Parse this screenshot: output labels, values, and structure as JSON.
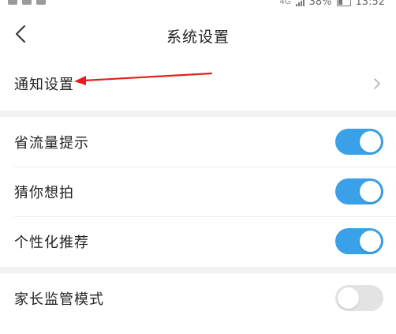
{
  "status_bar": {
    "network_label": "4G",
    "battery_text": "38%",
    "time": "13:52"
  },
  "header": {
    "title": "系统设置",
    "back_icon": "chevron-left-icon"
  },
  "notification_row": {
    "label": "通知设置",
    "chevron_icon": "chevron-right-icon"
  },
  "toggles": [
    {
      "label": "省流量提示",
      "enabled": true
    },
    {
      "label": "猜你想拍",
      "enabled": true
    },
    {
      "label": "个性化推荐",
      "enabled": true
    }
  ],
  "parental": {
    "label": "家长监管模式",
    "enabled": false
  },
  "colors": {
    "toggle_on": "#3aa0e8",
    "toggle_off": "#e3e3e3",
    "annotation_arrow": "#e0211b"
  }
}
